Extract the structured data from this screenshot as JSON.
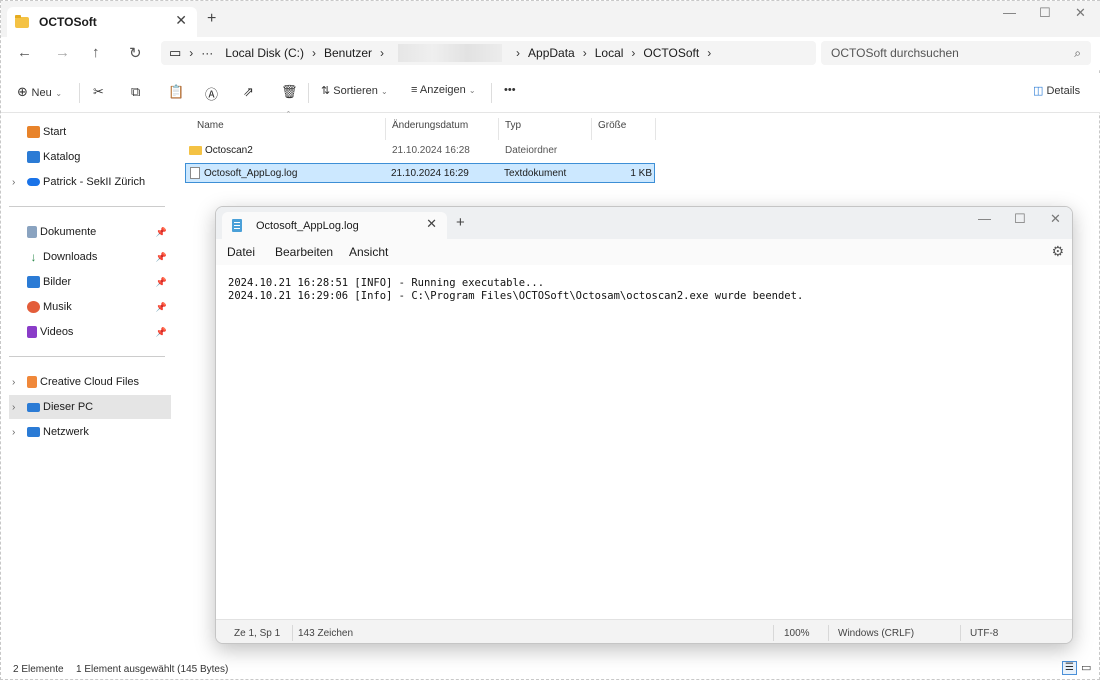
{
  "explorer": {
    "tab_title": "OCTOSoft",
    "close_glyph": "✕",
    "new_tab_glyph": "+",
    "window_controls": {
      "minimize": "—",
      "maximize": "☐",
      "close": "✕"
    },
    "nav": {
      "back": "←",
      "forward": "→",
      "up": "↑",
      "refresh": "↻"
    },
    "breadcrumb": {
      "more": "···",
      "sep": "›",
      "items": [
        "Local Disk (C:)",
        "Benutzer",
        "AppData",
        "Local",
        "OCTOSoft"
      ]
    },
    "search": {
      "placeholder": "OCTOSoft durchsuchen",
      "icon": "search-icon"
    },
    "toolbar": {
      "new_label": "Neu",
      "sort_label": "Sortieren",
      "view_label": "Anzeigen",
      "more_label": "•••",
      "details_label": "Details"
    },
    "sidebar": {
      "items": [
        {
          "label": "Start",
          "color": "#e8832a"
        },
        {
          "label": "Katalog",
          "color": "#2b7bd5"
        },
        {
          "label": "Patrick - SekII Zürich",
          "color": "#1a73e8"
        },
        {
          "label": "Dokumente",
          "color": "#8aa3c0"
        },
        {
          "label": "Downloads",
          "color": "#2a8a4a"
        },
        {
          "label": "Bilder",
          "color": "#2b7bd5"
        },
        {
          "label": "Musik",
          "color": "#e35d3a"
        },
        {
          "label": "Videos",
          "color": "#8a3cc8"
        },
        {
          "label": "Creative Cloud Files",
          "color": "#f0883a"
        },
        {
          "label": "Dieser PC",
          "color": "#2b7bd5"
        },
        {
          "label": "Netzwerk",
          "color": "#2b7bd5"
        }
      ]
    },
    "columns": [
      "Name",
      "Änderungsdatum",
      "Typ",
      "Größe"
    ],
    "files": [
      {
        "name": "Octoscan2",
        "date": "21.10.2024 16:28",
        "type": "Dateiordner",
        "size": ""
      },
      {
        "name": "Octosoft_AppLog.log",
        "date": "21.10.2024 16:29",
        "type": "Textdokument",
        "size": "1 KB"
      }
    ],
    "status": {
      "count": "2 Elemente",
      "selection": "1 Element ausgewählt (145 Bytes)"
    }
  },
  "notepad": {
    "tab_title": "Octosoft_AppLog.log",
    "close_glyph": "✕",
    "new_tab_glyph": "+",
    "window_controls": {
      "minimize": "—",
      "maximize": "☐",
      "close": "✕"
    },
    "menu": [
      "Datei",
      "Bearbeiten",
      "Ansicht"
    ],
    "lines": [
      "2024.10.21 16:28:51 [INFO] - Running executable...",
      "2024.10.21 16:29:06 [Info] - C:\\Program Files\\OCTOSoft\\Octosam\\octoscan2.exe wurde beendet."
    ],
    "status": {
      "position": "Ze 1, Sp 1",
      "chars": "143 Zeichen",
      "zoom": "100%",
      "line_ending": "Windows (CRLF)",
      "encoding": "UTF-8"
    }
  }
}
